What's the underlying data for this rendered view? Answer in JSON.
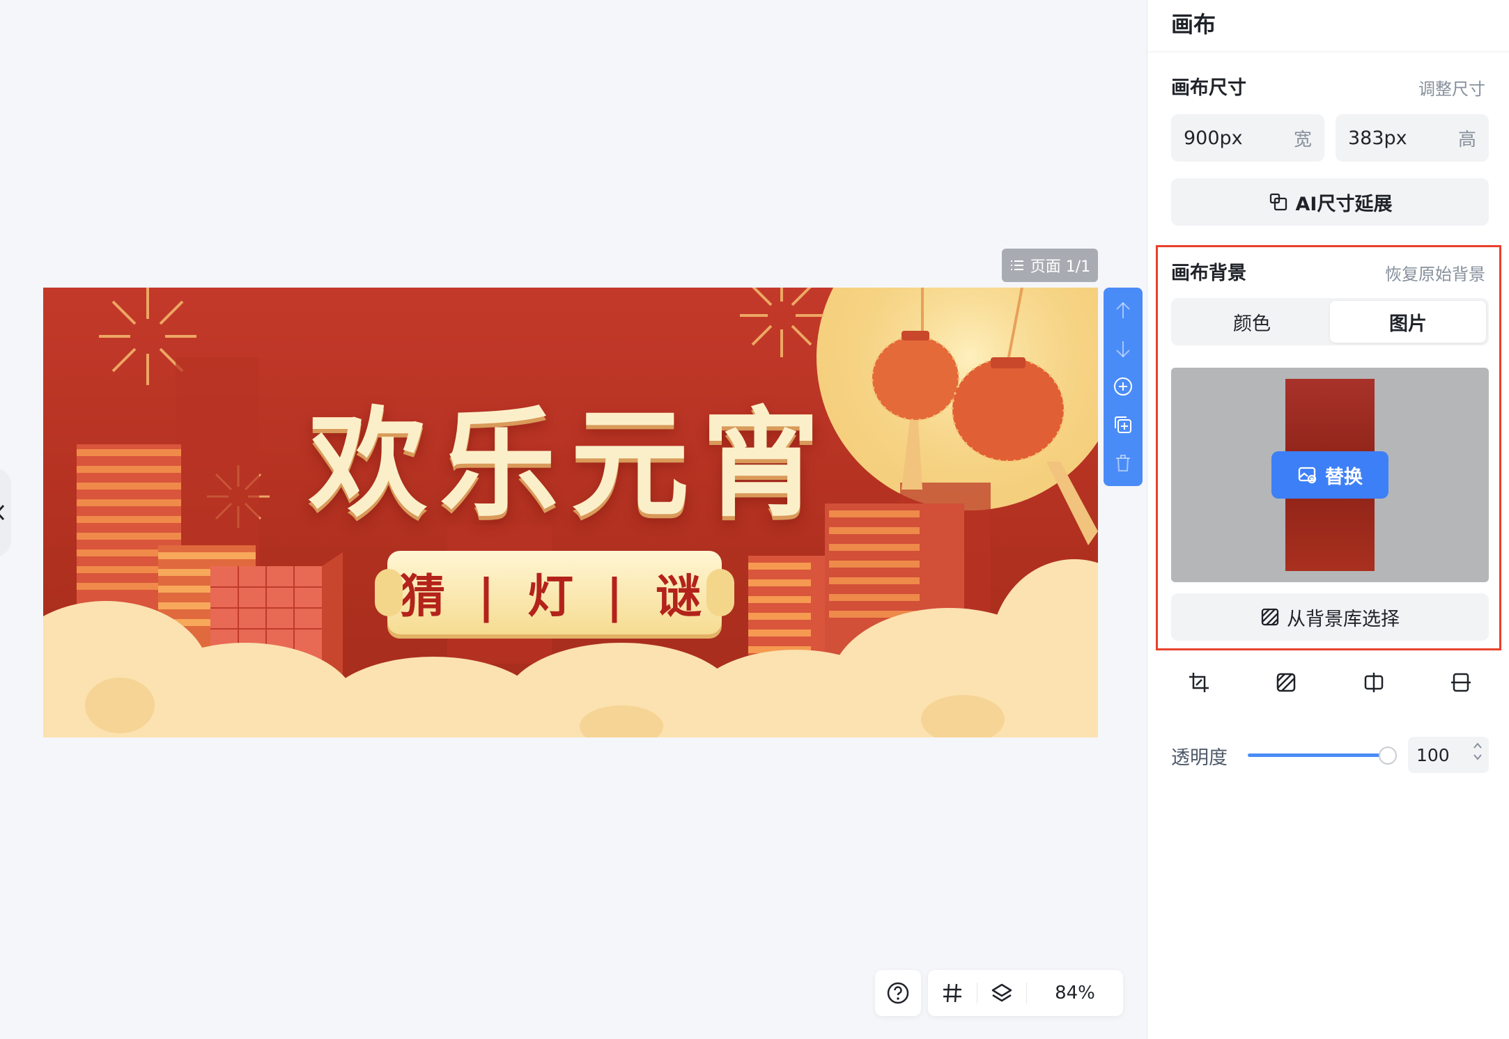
{
  "canvas": {
    "page_indicator": "页面 1/1",
    "banner": {
      "title": "欢乐元宵",
      "subtitle": "猜 | 灯 | 谜"
    },
    "toolbar_icons": [
      "arrow-up-icon",
      "arrow-down-icon",
      "add-page-icon",
      "duplicate-page-icon",
      "delete-page-icon"
    ],
    "bottom_bar": {
      "zoom": "84%",
      "icons": [
        "help-icon",
        "grid-icon",
        "layers-icon"
      ]
    }
  },
  "panel": {
    "title": "画布",
    "size": {
      "title": "画布尺寸",
      "adjust_link": "调整尺寸",
      "width_value": "900px",
      "width_unit": "宽",
      "height_value": "383px",
      "height_unit": "高",
      "ai_extend_label": "AI尺寸延展"
    },
    "background": {
      "title": "画布背景",
      "restore_link": "恢复原始背景",
      "tabs": [
        {
          "label": "颜色",
          "active": false
        },
        {
          "label": "图片",
          "active": true
        }
      ],
      "replace_label": "替换",
      "library_label": "从背景库选择"
    },
    "image_tools": [
      "crop-icon",
      "pattern-icon",
      "flip-horizontal-icon",
      "flip-vertical-icon"
    ],
    "opacity": {
      "label": "透明度",
      "value": "100",
      "level": 1.0
    }
  },
  "colors": {
    "accent": "#4a8cf7",
    "highlight_border": "#e8412c",
    "banner_red": "#c3392a",
    "banner_gold": "#fbefc9"
  }
}
